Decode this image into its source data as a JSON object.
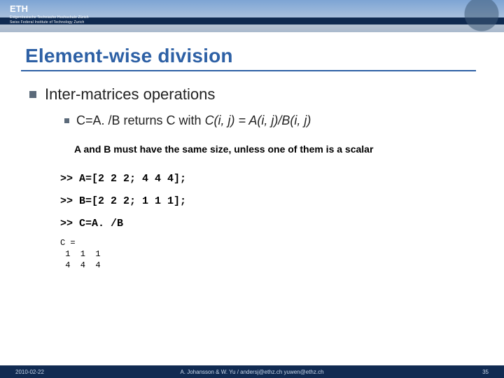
{
  "header": {
    "logo_text": "ETH",
    "subline1": "Eidgenössische Technische Hochschule Zürich",
    "subline2": "Swiss Federal Institute of Technology Zurich"
  },
  "title": "Element-wise division",
  "bullets": {
    "level1": "Inter-matrices operations",
    "level2_prefix": "C=A. /B returns C with ",
    "level2_formula": "C(i, j) = A(i, j)/B(i, j)"
  },
  "note": "A and B must have the same size, unless one of them is a scalar",
  "code": {
    "line1": ">> A=[2 2 2; 4 4 4];",
    "line2": ">> B=[2 2 2; 1 1 1];",
    "line3": ">> C=A. /B"
  },
  "output": "C =\n 1  1  1\n 4  4  4",
  "footer": {
    "date": "2010-02-22",
    "credits": "A. Johansson & W. Yu / andersj@ethz.ch  yuwen@ethz.ch",
    "page": "35"
  }
}
